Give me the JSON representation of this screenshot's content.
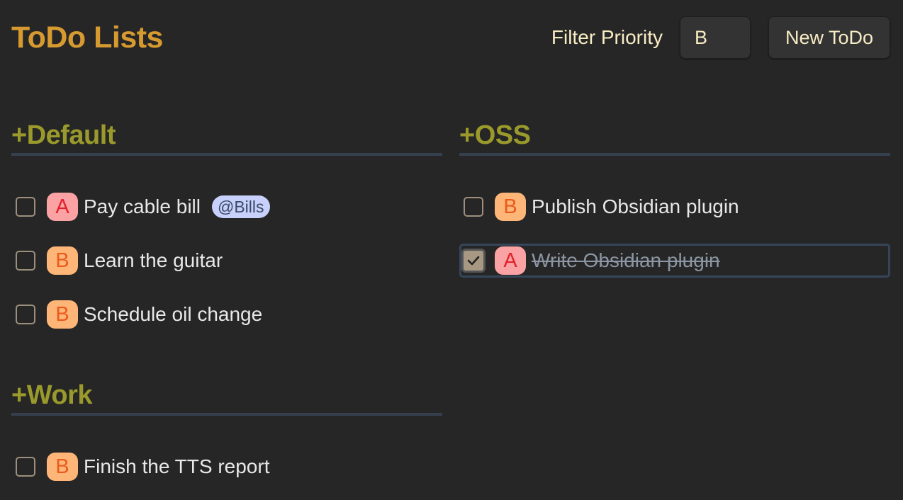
{
  "header": {
    "title": "ToDo Lists",
    "filter_label": "Filter Priority",
    "filter_value": "B",
    "new_button_label": "New ToDo"
  },
  "colors": {
    "background": "#262626",
    "title": "#d69a30",
    "list_header": "#9a9a2c",
    "priority_A_bg": "#fba3a4",
    "priority_A_text": "#e0222c",
    "priority_B_bg": "#fdb677",
    "priority_B_text": "#ea5a1e",
    "tag_bg": "#c7d1fb"
  },
  "lists": [
    {
      "name": "+Default",
      "items": [
        {
          "priority": "A",
          "text": "Pay cable bill",
          "tag": "@Bills",
          "done": false
        },
        {
          "priority": "B",
          "text": "Learn the guitar",
          "done": false
        },
        {
          "priority": "B",
          "text": "Schedule oil change",
          "done": false
        }
      ]
    },
    {
      "name": "+Work",
      "items": [
        {
          "priority": "B",
          "text": "Finish the TTS report",
          "done": false
        }
      ]
    },
    {
      "name": "+OSS",
      "items": [
        {
          "priority": "B",
          "text": "Publish Obsidian plugin",
          "done": false
        },
        {
          "priority": "A",
          "text": "Write Obsidian plugin",
          "done": true
        }
      ]
    }
  ]
}
